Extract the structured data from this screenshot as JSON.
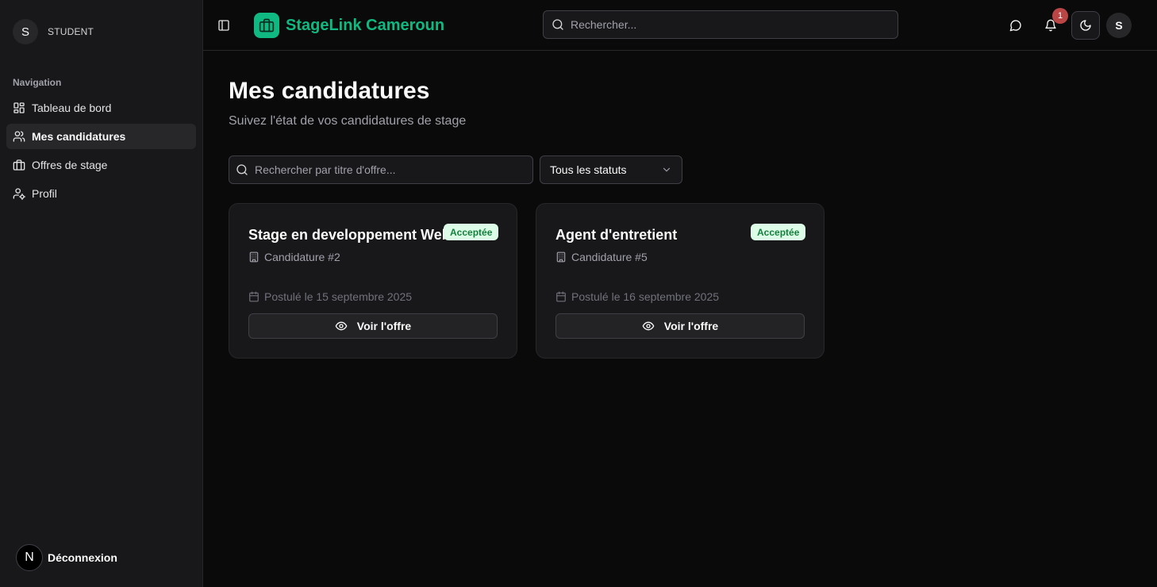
{
  "sidebar": {
    "avatar_initial": "S",
    "role": "STUDENT",
    "nav_heading": "Navigation",
    "items": [
      {
        "label": "Tableau de bord",
        "icon": "dashboard-icon",
        "active": false
      },
      {
        "label": "Mes candidatures",
        "icon": "users-icon",
        "active": true
      },
      {
        "label": "Offres de stage",
        "icon": "briefcase-icon",
        "active": false
      },
      {
        "label": "Profil",
        "icon": "user-cog-icon",
        "active": false
      }
    ],
    "logout_badge": "N",
    "logout_label": "Déconnexion"
  },
  "header": {
    "brand": "StageLink Cameroun",
    "search_placeholder": "Rechercher...",
    "notification_count": "1",
    "avatar_initial": "S"
  },
  "main": {
    "title": "Mes candidatures",
    "subtitle": "Suivez l'état de vos candidatures de stage",
    "search_placeholder": "Rechercher par titre d'offre...",
    "status_filter": "Tous les statuts",
    "cards": [
      {
        "title": "Stage en developpement Web",
        "status": "Acceptée",
        "reference": "Candidature #2",
        "applied": "Postulé le 15 septembre 2025",
        "button": "Voir l'offre"
      },
      {
        "title": "Agent d'entretient",
        "status": "Acceptée",
        "reference": "Candidature #5",
        "applied": "Postulé le 16 septembre 2025",
        "button": "Voir l'offre"
      }
    ]
  },
  "colors": {
    "brand": "#10b981",
    "badge_bg": "#dcfce7",
    "badge_text": "#15803d",
    "notification": "#b94545"
  }
}
